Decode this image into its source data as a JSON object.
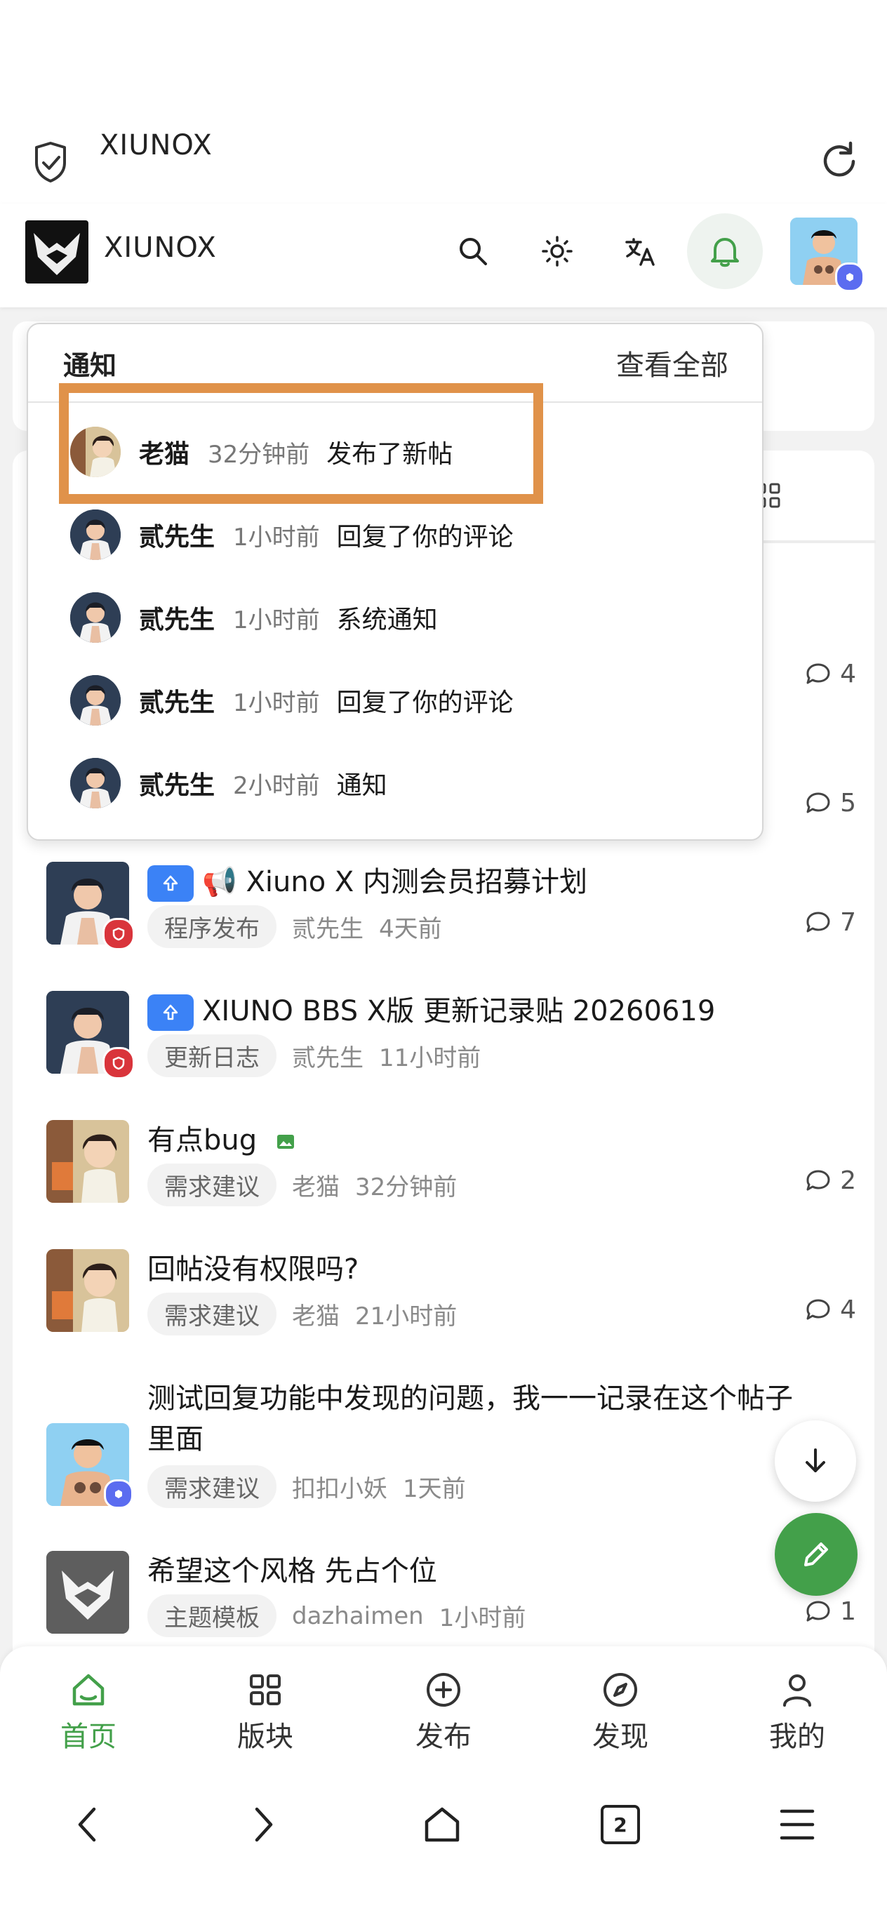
{
  "browser": {
    "title": "XIUNOX"
  },
  "site": {
    "name": "XIUNOX"
  },
  "notifications": {
    "title": "通知",
    "view_all": "查看全部",
    "items": [
      {
        "user": "老猫",
        "time": "32分钟前",
        "action": "发布了新帖"
      },
      {
        "user": "贰先生",
        "time": "1小时前",
        "action": "回复了你的评论"
      },
      {
        "user": "贰先生",
        "time": "1小时前",
        "action": "系统通知"
      },
      {
        "user": "贰先生",
        "time": "1小时前",
        "action": "回复了你的评论"
      },
      {
        "user": "贰先生",
        "time": "2小时前",
        "action": "通知"
      }
    ]
  },
  "threads_behind": {
    "replies": [
      "4",
      "5"
    ]
  },
  "threads": [
    {
      "title": "📢 Xiuno X 内测会员招募计划",
      "category": "程序发布",
      "author": "贰先生",
      "time": "4天前",
      "replies": "7",
      "pinned": true
    },
    {
      "title": "XIUNO BBS X版 更新记录贴 20260619",
      "category": "更新日志",
      "author": "贰先生",
      "time": "11小时前",
      "replies": "",
      "pinned": true
    },
    {
      "title": "有点bug",
      "category": "需求建议",
      "author": "老猫",
      "time": "32分钟前",
      "replies": "2",
      "has_image": true
    },
    {
      "title": "回帖没有权限吗?",
      "category": "需求建议",
      "author": "老猫",
      "time": "21小时前",
      "replies": "4"
    },
    {
      "title_line1": "测试回复功能中发现的问题，我一一记录在这个帖子",
      "title_line2": "里面",
      "category": "需求建议",
      "author": "扣扣小妖",
      "time": "1天前",
      "replies": ""
    },
    {
      "title": "希望这个风格 先占个位",
      "category": "主题模板",
      "author": "dazhaimen",
      "time": "1小时前",
      "replies": "1"
    }
  ],
  "tabs": [
    {
      "label": "首页",
      "icon": "home-icon",
      "active": true
    },
    {
      "label": "版块",
      "icon": "grid-icon"
    },
    {
      "label": "发布",
      "icon": "plus-circle-icon"
    },
    {
      "label": "发现",
      "icon": "compass-icon"
    },
    {
      "label": "我的",
      "icon": "user-icon"
    }
  ],
  "system_nav": {
    "tab_count": "2"
  },
  "colors": {
    "accent": "#43a04a",
    "pin": "#3b82f6",
    "highlight": "#e0924a",
    "admin_badge": "#d9343b"
  }
}
